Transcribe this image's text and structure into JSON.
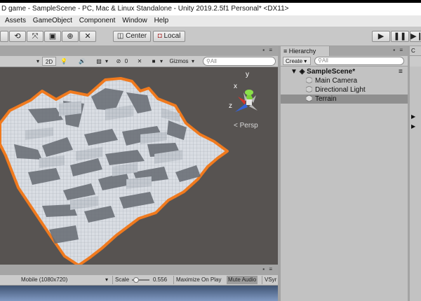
{
  "window": {
    "title": "D game - SampleScene - PC, Mac & Linux Standalone - Unity 2019.2.5f1 Personal* <DX11>"
  },
  "menu": {
    "items": [
      "Assets",
      "GameObject",
      "Component",
      "Window",
      "Help"
    ]
  },
  "toolbar": {
    "center_label": "Center",
    "local_label": "Local"
  },
  "scene_toolbar": {
    "mode_2d": "2D",
    "hidden_count": "0",
    "gizmos_label": "Gizmos",
    "search_placeholder": "All",
    "persp_label": "< Persp"
  },
  "gizmo": {
    "y_label": "y",
    "x_label": "x",
    "z_label": "z"
  },
  "game_toolbar": {
    "resolution": "Mobile (1080x720)",
    "scale_label": "Scale",
    "scale_value": "0.556",
    "maximize_label": "Maximize On Play",
    "mute_label": "Mute Audio",
    "vsync_label": "VSyr"
  },
  "hierarchy": {
    "tab_label": "Hierarchy",
    "create_label": "Create",
    "search_placeholder": "All",
    "scene_name": "SampleScene*",
    "objects": [
      "Main Camera",
      "Directional Light",
      "Terrain"
    ],
    "selected": "Terrain"
  },
  "inspector": {
    "tab_label": "C"
  },
  "colors": {
    "viewport_bg": "#575351",
    "terrain_outline": "#f07a1e",
    "selected_row": "#8f8f8f"
  }
}
